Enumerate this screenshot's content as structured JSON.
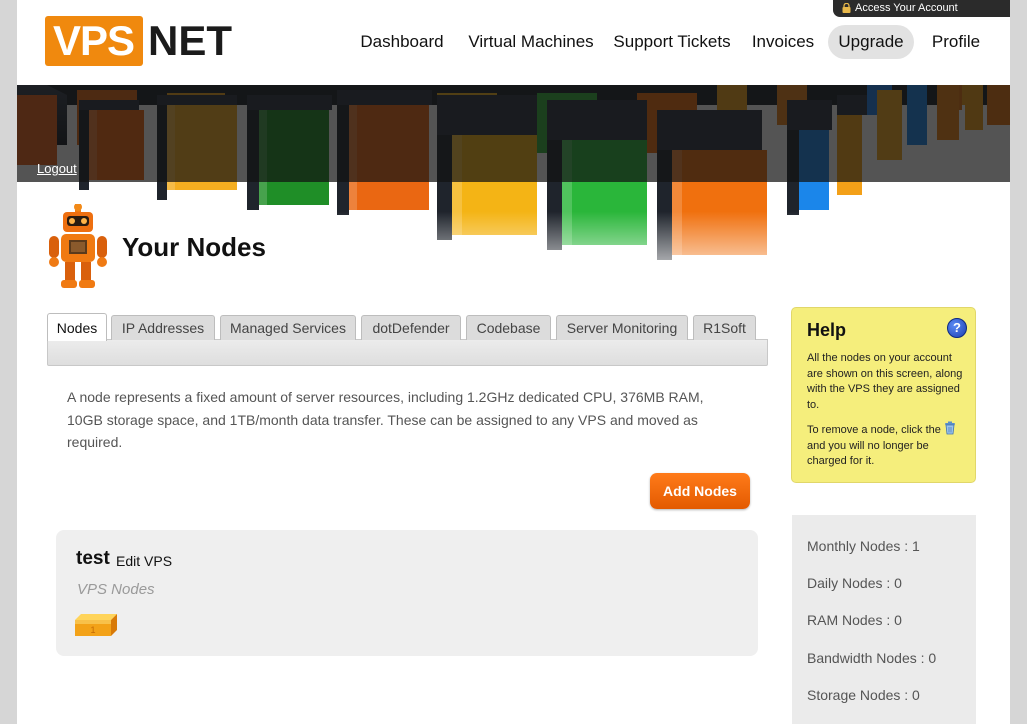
{
  "header": {
    "logo_left": "VPS",
    "logo_right": "NET",
    "access_account": "Access Your Account",
    "nav": [
      {
        "label": "Dashboard",
        "active": false
      },
      {
        "label": "Virtual Machines",
        "active": false
      },
      {
        "label": "Support Tickets",
        "active": false
      },
      {
        "label": "Invoices",
        "active": false
      },
      {
        "label": "Upgrade",
        "active": true
      },
      {
        "label": "Profile",
        "active": false
      }
    ],
    "logout": "Logout"
  },
  "page": {
    "title": "Your Nodes",
    "tabs": [
      "Nodes",
      "IP Addresses",
      "Managed Services",
      "dotDefender",
      "Codebase",
      "Server Monitoring",
      "R1Soft"
    ],
    "active_tab": "Nodes",
    "description": "A node represents a fixed amount of server resources, including 1.2GHz dedicated CPU, 376MB RAM, 10GB storage space, and 1TB/month data transfer. These can be assigned to any VPS and moved as required.",
    "add_nodes_label": "Add Nodes",
    "vps": {
      "name": "test",
      "edit_label": "Edit VPS",
      "nodes_label": "VPS Nodes"
    }
  },
  "help": {
    "title": "Help",
    "icon": "?",
    "paragraph1": "All the nodes on your account are shown on this screen, along with the VPS they are assigned to.",
    "paragraph2_before": "To remove a node, click the",
    "paragraph2_after": "and you will no longer be charged for it."
  },
  "stats": [
    "Monthly Nodes : 1",
    "Daily Nodes : 0",
    "RAM Nodes : 0",
    "Bandwidth Nodes : 0",
    "Storage Nodes : 0"
  ],
  "colors": {
    "brand_orange": "#f0890e",
    "button_orange": "#f06a0a",
    "help_yellow": "#f5ee7c",
    "dark_band": "#1e1e1e"
  }
}
